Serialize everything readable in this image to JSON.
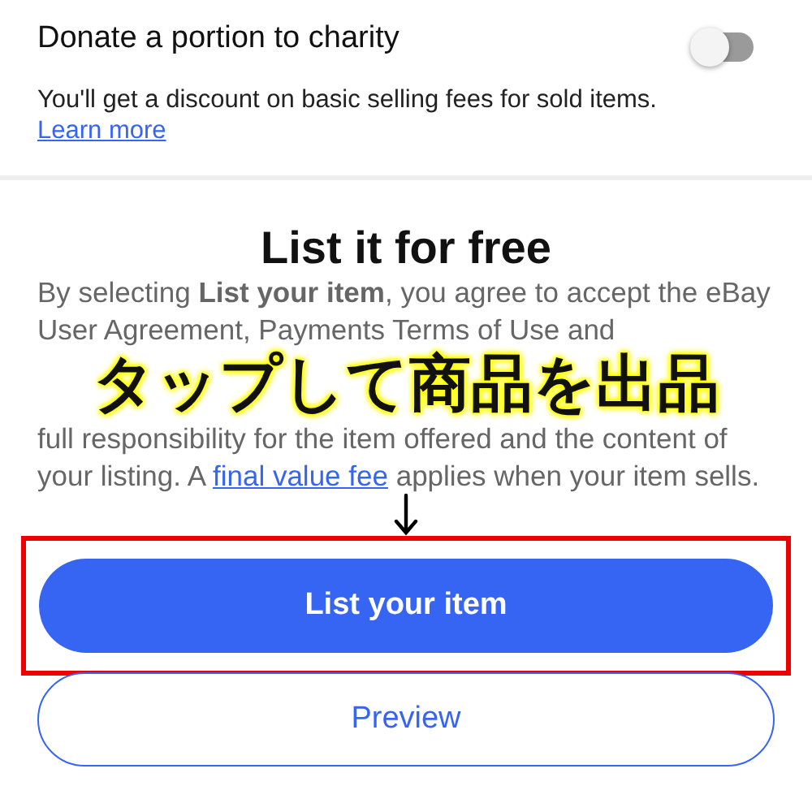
{
  "charity": {
    "label": "Donate a portion to charity",
    "on": false
  },
  "discount": {
    "text": "You'll get a discount on basic selling fees for sold items.",
    "link": "Learn more"
  },
  "listing": {
    "title": "List it for free",
    "terms_top": "By selecting **List your item**, you agree to accept the eBay User Agreement, Payments Terms of Use and",
    "terms_bottom_before": "full responsibility for the item offered and the content of your listing. A",
    "terms_link": "final value fee",
    "terms_bottom_after": "applies when your item sells.",
    "annotation": "タップして商品を出品",
    "buttons": [
      {
        "label": "List your item",
        "kind": "primary",
        "highlighted": true
      },
      {
        "label": "Preview",
        "kind": "secondary",
        "highlighted": false
      }
    ]
  }
}
